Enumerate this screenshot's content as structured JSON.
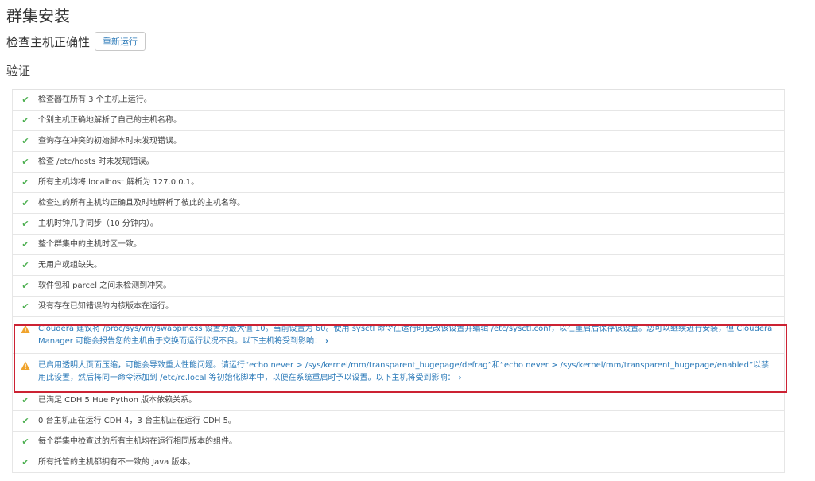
{
  "page": {
    "title": "群集安装",
    "check_title": "检查主机正确性",
    "rerun_label": "重新运行",
    "section_title": "验证"
  },
  "colors": {
    "success": "#4caf50",
    "warning_icon": "#f0a32c",
    "warning_text": "#2a79b8",
    "highlight": "#cc2233"
  },
  "results": [
    {
      "status": "ok",
      "icon": "check-icon",
      "text": "检查器在所有 3 个主机上运行。"
    },
    {
      "status": "ok",
      "icon": "check-icon",
      "text": "个别主机正确地解析了自己的主机名称。"
    },
    {
      "status": "ok",
      "icon": "check-icon",
      "text": "查询存在冲突的初始脚本时未发现错误。"
    },
    {
      "status": "ok",
      "icon": "check-icon",
      "text": "检查 /etc/hosts 时未发现错误。"
    },
    {
      "status": "ok",
      "icon": "check-icon",
      "text": "所有主机均将 localhost 解析为 127.0.0.1。"
    },
    {
      "status": "ok",
      "icon": "check-icon",
      "text": "检查过的所有主机均正确且及时地解析了彼此的主机名称。"
    },
    {
      "status": "ok",
      "icon": "check-icon",
      "text": "主机时钟几乎同步（10 分钟内）。"
    },
    {
      "status": "ok",
      "icon": "check-icon",
      "text": "整个群集中的主机时区一致。"
    },
    {
      "status": "ok",
      "icon": "check-icon",
      "text": "无用户或组缺失。"
    },
    {
      "status": "ok",
      "icon": "check-icon",
      "text": "软件包和 parcel 之间未检测到冲突。"
    },
    {
      "status": "ok",
      "icon": "check-icon",
      "text": "没有存在已知错误的内核版本在运行。"
    },
    {
      "status": "warn",
      "icon": "warning-icon",
      "text": "Cloudera 建议将 /proc/sys/vm/swappiness 设置为最大值 10。当前设置为 60。使用 sysctl 命令在运行时更改该设置并编辑 /etc/sysctl.conf，以在重启后保存该设置。您可以继续进行安装，但 Cloudera Manager 可能会报告您的主机由于交换而运行状况不良。以下主机将受到影响："
    },
    {
      "status": "warn",
      "icon": "warning-icon",
      "text": "已启用透明大页面压缩，可能会导致重大性能问题。请运行“echo never > /sys/kernel/mm/transparent_hugepage/defrag”和“echo never > /sys/kernel/mm/transparent_hugepage/enabled”以禁用此设置，然后将同一命令添加到 /etc/rc.local 等初始化脚本中，以便在系统重启时予以设置。以下主机将受到影响："
    },
    {
      "status": "ok",
      "icon": "check-icon",
      "text": "已满足 CDH 5 Hue Python 版本依赖关系。"
    },
    {
      "status": "ok",
      "icon": "check-icon",
      "text": "0 台主机正在运行 CDH 4，3 台主机正在运行 CDH 5。"
    },
    {
      "status": "ok",
      "icon": "check-icon",
      "text": "每个群集中检查过的所有主机均在运行相同版本的组件。"
    },
    {
      "status": "ok",
      "icon": "check-icon",
      "text": "所有托管的主机都拥有不一致的 Java 版本。"
    }
  ]
}
